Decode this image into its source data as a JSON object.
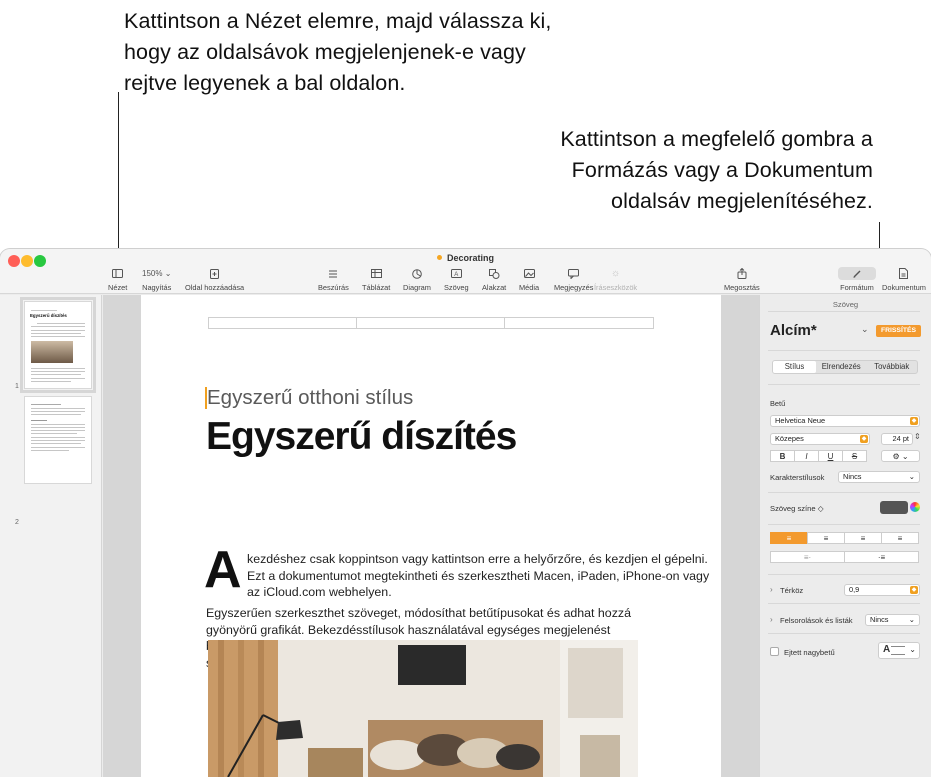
{
  "callouts": {
    "left": [
      "Kattintson a Nézet elemre, majd válassza ki,",
      "hogy az oldalsávok megjelenjenek-e vagy",
      "rejtve legyenek a bal oldalon."
    ],
    "right": [
      "Kattintson a megfelelő gombra a",
      "Formázás vagy a Dokumentum",
      "oldalsáv megjelenítéséhez."
    ]
  },
  "window": {
    "title": "Decorating",
    "colors": {
      "close": "#ff5f57",
      "minimize": "#febc2e",
      "zoom": "#28c840",
      "accent": "#f0a020"
    }
  },
  "toolbar": {
    "view": "Nézet",
    "zoom_value": "150%",
    "zoom_label": "Nagyítás",
    "add_page": "Oldal hozzáadása",
    "insert": "Beszúrás",
    "table": "Táblázat",
    "chart": "Diagram",
    "text": "Szöveg",
    "shape": "Alakzat",
    "media": "Média",
    "comment": "Megjegyzés",
    "writing_tools": "Íráseszközök",
    "share": "Megosztás",
    "format": "Formátum",
    "document": "Dokumentum"
  },
  "thumbnails": [
    {
      "number": "1",
      "title": "Egyszerű díszítés"
    },
    {
      "number": "2",
      "title": ""
    }
  ],
  "document": {
    "subtitle": "Egyszerű otthoni stílus",
    "title": "Egyszerű díszítés",
    "dropcap": "A",
    "para1": "kezdéshez csak koppintson vagy kattintson erre a helyőrzőre, és kezdjen el gépelni. Ezt a dokumentumot megtekintheti és szerkesztheti Macen, iPaden, iPhone-on vagy az iCloud.com webhelyen.",
    "para2": "Egyszerűen szerkeszthet szöveget, módosíthat betűtípusokat és adhat hozzá gyönyörű grafikát. Bekezdésstílusok használatával egységes megjelenést biztosíthat a teljes dokumentumnak. Például ez a bekezdés a Szövegtörzs stílust használja. Ezt a Formátum vezérlők Szöveg lapján módosíthatja."
  },
  "inspector": {
    "header": "Szöveg",
    "style_name": "Alcím*",
    "update_button": "FRISSÍTÉS",
    "tabs": [
      "Stílus",
      "Elrendezés",
      "Továbbiak"
    ],
    "font_section": "Betű",
    "font_family": "Helvetica Neue",
    "font_weight": "Közepes",
    "font_size": "24 pt",
    "char_buttons": [
      "B",
      "I",
      "U",
      "S"
    ],
    "char_styles_label": "Karakterstílusok",
    "char_styles_value": "Nincs",
    "text_color_label": "Szöveg színe ◇",
    "spacing_label": "Térköz",
    "spacing_value": "0,9",
    "bullets_label": "Felsorolások és listák",
    "bullets_value": "Nincs",
    "dropcap_label": "Ejtett nagybetű",
    "dropcap_preview": "A"
  }
}
